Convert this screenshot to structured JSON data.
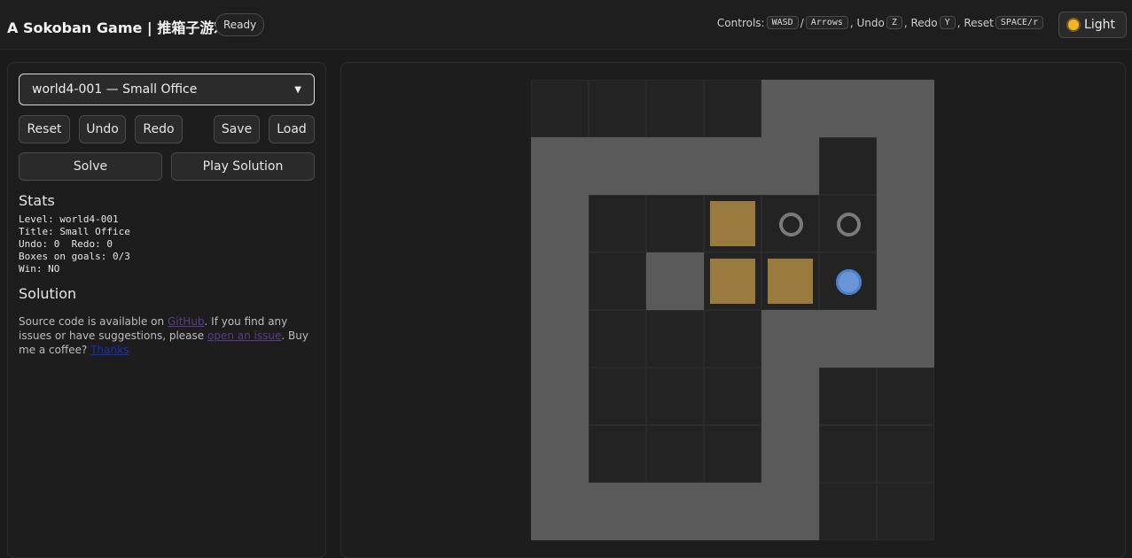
{
  "header": {
    "title": "A Sokoban Game | 推箱子游戏",
    "status": "Ready",
    "controls": {
      "label": "Controls:",
      "move_keys_1": "WASD",
      "separator": "/",
      "move_keys_2": "Arrows",
      "undo_label": ", Undo",
      "undo_key": "Z",
      "redo_label": ", Redo",
      "redo_key": "Y",
      "reset_label": ", Reset",
      "reset_key": "SPACE/r"
    },
    "theme_button": "Light"
  },
  "sidebar": {
    "level_select": "world4-001 — Small Office",
    "buttons": {
      "reset": "Reset",
      "undo": "Undo",
      "redo": "Redo",
      "save": "Save",
      "load": "Load",
      "solve": "Solve",
      "play_solution": "Play Solution"
    },
    "stats_title": "Stats",
    "stats": {
      "line1": "Level: world4-001",
      "line2": "Title: Small Office",
      "line3": "Undo: 0  Redo: 0",
      "line4": "Boxes on goals: 0/3",
      "line5": "Win: NO"
    },
    "solution_title": "Solution",
    "footer": {
      "pre": "Source code is available on ",
      "github": "GitHub",
      "mid": ". If you find any issues or have suggestions, please ",
      "issue": "open an issue",
      "post": ". Buy me a coffee? ",
      "thanks": "Thanks"
    }
  },
  "board": {
    "cols": 7,
    "rows": 8,
    "legend": "# wall, . floor, _ outside floor, B box, G goal, P player",
    "map": [
      "____###",
      "#####_#",
      "#__BGG#",
      "#_#BBP#",
      "#___###",
      "#___#__",
      "#___#__",
      "#####__"
    ],
    "boxes_on_goals": "0/3"
  }
}
